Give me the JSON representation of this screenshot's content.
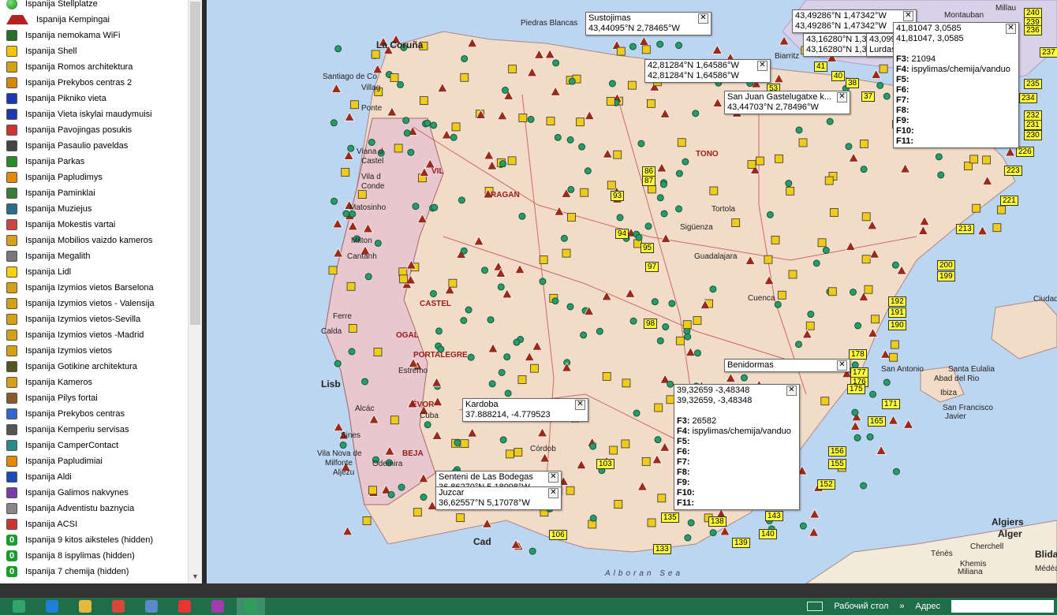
{
  "layers": [
    {
      "label": "Ispanija Stellplatze",
      "icon": "green-dot-icon",
      "color": "#1a9b2e"
    },
    {
      "label": "Ispanija Kempingai",
      "icon": "red-tent-icon",
      "color": "#b22222"
    },
    {
      "label": "Ispanija nemokama WiFi",
      "icon": "wifi-icon",
      "color": "#2a6e2a"
    },
    {
      "label": "Ispanija Shell",
      "icon": "shell-icon",
      "color": "#f3c200"
    },
    {
      "label": "Ispanija Romos architektura",
      "icon": "roman-arch-icon",
      "color": "#d4a017"
    },
    {
      "label": "Ispanija Prekybos centras 2",
      "icon": "shopping-center-icon",
      "color": "#d48a00"
    },
    {
      "label": "Ispanija Pikniko vieta",
      "icon": "picnic-table-icon",
      "color": "#1c39b0"
    },
    {
      "label": "Ispanija Vieta iskylai maudymuisi",
      "icon": "swim-picnic-icon",
      "color": "#1c39b0"
    },
    {
      "label": "Ispanija Pavojingas posukis",
      "icon": "danger-curve-icon",
      "color": "#c33"
    },
    {
      "label": "Ispanija Pasaulio paveldas",
      "icon": "world-heritage-icon",
      "color": "#444"
    },
    {
      "label": "Ispanija Parkas",
      "icon": "park-icon",
      "color": "#2a8a2a"
    },
    {
      "label": "Ispanija Papludimys",
      "icon": "beach-icon",
      "color": "#e08a00"
    },
    {
      "label": "Ispanija Paminklai",
      "icon": "monument-icon",
      "color": "#3a7d3a"
    },
    {
      "label": "Ispanija Muziejus",
      "icon": "museum-icon",
      "color": "#2d6b8a"
    },
    {
      "label": "Ispanija Mokestis vartai",
      "icon": "toll-gate-icon",
      "color": "#c44"
    },
    {
      "label": "Ispanija Mobilios vaizdo kameros",
      "icon": "mobile-camera-icon",
      "color": "#d4a017"
    },
    {
      "label": "Ispanija Megalith",
      "icon": "megalith-icon",
      "color": "#777"
    },
    {
      "label": "Ispanija Lidl",
      "icon": "lidl-icon",
      "color": "#f7d100"
    },
    {
      "label": "Ispanija Izymios vietos Barselona",
      "icon": "poi-barcelona-icon",
      "color": "#d4a017"
    },
    {
      "label": "Ispanija Izymios vietos - Valensija",
      "icon": "poi-valencia-icon",
      "color": "#d4a017"
    },
    {
      "label": "Ispanija Izymios vietos-Sevilla",
      "icon": "poi-sevilla-icon",
      "color": "#d4a017"
    },
    {
      "label": "Ispanija Izymios vietos -Madrid",
      "icon": "poi-madrid-icon",
      "color": "#d4a017"
    },
    {
      "label": "Ispanija  Izymios vietos",
      "icon": "poi-icon",
      "color": "#d4a017"
    },
    {
      "label": "Ispanija Gotikine architektura",
      "icon": "gothic-icon",
      "color": "#552"
    },
    {
      "label": "Ispanija Kameros",
      "icon": "camera-icon",
      "color": "#d4a017"
    },
    {
      "label": "Ispanija Pilys fortai",
      "icon": "castle-icon",
      "color": "#8b5a2b"
    },
    {
      "label": "Ispanija Prekybos centras",
      "icon": "shopping-icon",
      "color": "#3366cc"
    },
    {
      "label": "Ispanija Kemperiu servisas",
      "icon": "camper-service-icon",
      "color": "#555"
    },
    {
      "label": "Ispanija CamperContact",
      "icon": "campercontact-icon",
      "color": "#2a8a8a"
    },
    {
      "label": "Ispanija Papludimiai",
      "icon": "beaches-icon",
      "color": "#e08a00"
    },
    {
      "label": "Ispanija Aldi",
      "icon": "aldi-icon",
      "color": "#1b4ab5"
    },
    {
      "label": "Ispanija Galimos nakvynes",
      "icon": "overnight-icon",
      "color": "#7a3aa8"
    },
    {
      "label": "Ispanija Adventistu baznycia",
      "icon": "church-icon",
      "color": "#888"
    },
    {
      "label": "Ispanija ACSI",
      "icon": "acsi-icon",
      "color": "#c33"
    },
    {
      "label": "Ispanija 9 kitos aiksteles (hidden)",
      "icon": "zero-icon",
      "color": "#1a9b2e"
    },
    {
      "label": "Ispanija 8 ispylimas (hidden)",
      "icon": "zero-icon",
      "color": "#1a9b2e"
    },
    {
      "label": "Ispanija 7 chemija (hidden)",
      "icon": "zero-icon",
      "color": "#1a9b2e"
    }
  ],
  "places": [
    {
      "label": "Piedras Blancas",
      "big": false
    },
    {
      "label": "La Coruña",
      "big": true
    },
    {
      "label": "Santiago de Co",
      "big": false
    },
    {
      "label": "Villag",
      "big": false
    },
    {
      "label": "Ponte",
      "big": false
    },
    {
      "label": "Viana d",
      "big": false
    },
    {
      "label": "Castel",
      "big": false
    },
    {
      "label": "Vila d",
      "big": false
    },
    {
      "label": "Conde",
      "big": false
    },
    {
      "label": "Matosinho",
      "big": false
    },
    {
      "label": "Cantanh",
      "big": false
    },
    {
      "label": "Milton",
      "big": false
    },
    {
      "label": "Ferre",
      "big": false
    },
    {
      "label": "Calda",
      "big": false
    },
    {
      "label": "Lisb",
      "big": true
    },
    {
      "label": "Alcác",
      "big": false
    },
    {
      "label": "Sines",
      "big": false
    },
    {
      "label": "Vila Nova de",
      "big": false
    },
    {
      "label": "Milfonte",
      "big": false
    },
    {
      "label": "Aljezu",
      "big": false
    },
    {
      "label": "Odemira",
      "big": false
    },
    {
      "label": "Cuba",
      "big": false
    },
    {
      "label": "Estremo",
      "big": false
    },
    {
      "label": "Córdob",
      "big": false
    },
    {
      "label": "Cad",
      "big": true
    },
    {
      "label": "Montauban",
      "big": false
    },
    {
      "label": "Millau",
      "big": false
    },
    {
      "label": "Biarritz",
      "big": false
    },
    {
      "label": "Sigüenza",
      "big": false
    },
    {
      "label": "Guadalajara",
      "big": false
    },
    {
      "label": "Cuenca",
      "big": false
    },
    {
      "label": "Tortola",
      "big": false
    },
    {
      "label": "San Antonio",
      "big": false
    },
    {
      "label": "Santa Eulalia",
      "big": false
    },
    {
      "label": "Abad del Rio",
      "big": false
    },
    {
      "label": "Ibiza",
      "big": false
    },
    {
      "label": "San Francisco",
      "big": false
    },
    {
      "label": "Javier",
      "big": false
    },
    {
      "label": "Algiers",
      "big": true
    },
    {
      "label": "Alger",
      "big": true
    },
    {
      "label": "Cherchell",
      "big": false
    },
    {
      "label": "Ténès",
      "big": false
    },
    {
      "label": "Khemis",
      "big": false
    },
    {
      "label": "Miliana",
      "big": false
    },
    {
      "label": "Blida",
      "big": true
    },
    {
      "label": "Médéa",
      "big": false
    },
    {
      "label": "Ciudad",
      "big": false
    }
  ],
  "regions": [
    "VIL",
    "RAGAN",
    "TONO",
    "PORTALEGRE",
    "ÉVOR",
    "BEJA",
    "CASTEL",
    "OGAL"
  ],
  "sea_label": "Alboran Sea",
  "number_labels": [
    "240",
    "239",
    "236",
    "237",
    "235",
    "234",
    "232",
    "231",
    "230",
    "226",
    "223",
    "221",
    "213",
    "200",
    "199",
    "192",
    "191",
    "190",
    "178",
    "177",
    "176",
    "175",
    "171",
    "165",
    "156",
    "155",
    "152",
    "143",
    "140",
    "139",
    "138",
    "135",
    "133",
    "106",
    "103",
    "98",
    "97",
    "95",
    "94",
    "93",
    "87",
    "86",
    "53",
    "41",
    "40",
    "38",
    "37"
  ],
  "popups": [
    {
      "title": "Sustojimas",
      "line": "43,44095°N 2,78465°W",
      "fields": []
    },
    {
      "title": "42,81284°N 1,64586°W",
      "line": "42,81284°N 1,64586°W",
      "fields": []
    },
    {
      "title": "San Juan Gastelugatxe k...",
      "line": "43,44703°N 2,78496°W",
      "fields": []
    },
    {
      "title": "43,49286°N 1,47342°W",
      "line": "43,49286°N 1,47342°W",
      "fields": []
    },
    {
      "title": "43,16280°N 1,3",
      "line": "43,16280°N 1,309",
      "fields": []
    },
    {
      "title": "43,099",
      "line": "Lurdas",
      "fields": []
    },
    {
      "title": "41,81047 3,0585",
      "line": "41,81047, 3,0585",
      "fields": [
        {
          "k": "F3:",
          "v": "21094"
        },
        {
          "k": "F4:",
          "v": "ispylimas/chemija/vanduo"
        },
        {
          "k": "F5:",
          "v": ""
        },
        {
          "k": "F6:",
          "v": ""
        },
        {
          "k": "F7:",
          "v": ""
        },
        {
          "k": "F8:",
          "v": ""
        },
        {
          "k": "F9:",
          "v": ""
        },
        {
          "k": "F10:",
          "v": ""
        },
        {
          "k": "F11:",
          "v": ""
        }
      ]
    },
    {
      "title": "Benidormas",
      "line": "",
      "fields": []
    },
    {
      "title": "39,32659 -3,48348",
      "line": "39,32659, -3,48348",
      "fields": [
        {
          "k": "F3:",
          "v": "26582"
        },
        {
          "k": "F4:",
          "v": "ispylimas/chemija/vanduo"
        },
        {
          "k": "F5:",
          "v": ""
        },
        {
          "k": "F6:",
          "v": ""
        },
        {
          "k": "F7:",
          "v": ""
        },
        {
          "k": "F8:",
          "v": ""
        },
        {
          "k": "F9:",
          "v": ""
        },
        {
          "k": "F10:",
          "v": ""
        },
        {
          "k": "F11:",
          "v": ""
        }
      ]
    },
    {
      "title": "Kardoba",
      "line": "37.888214, -4.779523",
      "fields": []
    },
    {
      "title": "Senteni de Las Bodegas",
      "line": "36,86270°N 5,18098°W",
      "fields": []
    },
    {
      "title": "Juzcar",
      "line": "36,62557°N 5,17078°W",
      "fields": []
    }
  ],
  "taskbar": {
    "desktop_label": "Рабочий стол",
    "address_label": "Адрес",
    "chevrons": "»",
    "apps": [
      {
        "name": "start-icon",
        "color": "#2fa56c"
      },
      {
        "name": "ie-icon",
        "color": "#1e7fd6"
      },
      {
        "name": "explorer-icon",
        "color": "#e6b83d"
      },
      {
        "name": "chrome-icon",
        "color": "#d9473a"
      },
      {
        "name": "app-icon",
        "color": "#5a89c8"
      },
      {
        "name": "yandex-icon",
        "color": "#e33"
      },
      {
        "name": "media-icon",
        "color": "#a23bb0"
      },
      {
        "name": "map-app-icon",
        "color": "#2e9f5a"
      }
    ]
  },
  "colors": {
    "sea": "#bcd5f0",
    "land_spain": "#f2dcc8",
    "land_portugal": "#e8c7cf",
    "france": "#d9d1e8",
    "taskbar": "#1f6e4a",
    "label_yellow": "#ffff3a"
  }
}
